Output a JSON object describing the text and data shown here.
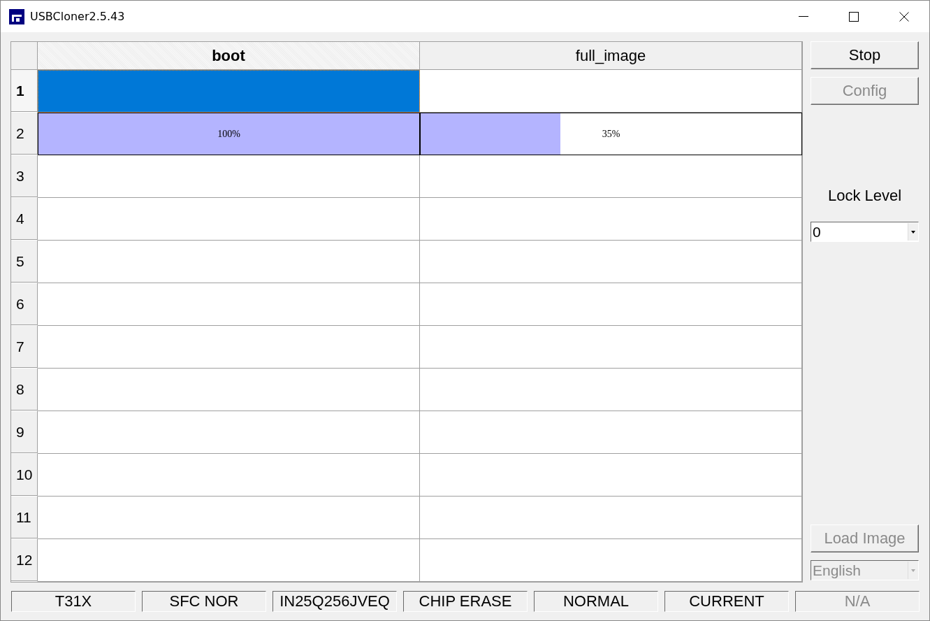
{
  "window": {
    "title": "USBCloner2.5.43"
  },
  "table": {
    "columns": [
      {
        "label": "boot",
        "selected": true
      },
      {
        "label": "full_image",
        "selected": false
      }
    ],
    "rows": [
      {
        "label": "1",
        "selected": true,
        "cells": [
          {
            "kind": "empty",
            "selected": true
          },
          {
            "kind": "empty",
            "selected": false
          }
        ]
      },
      {
        "label": "2",
        "selected": false,
        "cells": [
          {
            "kind": "progress",
            "level": 1.0,
            "text": "100%"
          },
          {
            "kind": "progress",
            "level": 0.367,
            "text": "35%"
          }
        ]
      },
      {
        "label": "3",
        "selected": false,
        "cells": [
          {
            "kind": "empty",
            "selected": false
          },
          {
            "kind": "empty",
            "selected": false
          }
        ]
      },
      {
        "label": "4",
        "selected": false,
        "cells": [
          {
            "kind": "empty",
            "selected": false
          },
          {
            "kind": "empty",
            "selected": false
          }
        ]
      },
      {
        "label": "5",
        "selected": false,
        "cells": [
          {
            "kind": "empty",
            "selected": false
          },
          {
            "kind": "empty",
            "selected": false
          }
        ]
      },
      {
        "label": "6",
        "selected": false,
        "cells": [
          {
            "kind": "empty",
            "selected": false
          },
          {
            "kind": "empty",
            "selected": false
          }
        ]
      },
      {
        "label": "7",
        "selected": false,
        "cells": [
          {
            "kind": "empty",
            "selected": false
          },
          {
            "kind": "empty",
            "selected": false
          }
        ]
      },
      {
        "label": "8",
        "selected": false,
        "cells": [
          {
            "kind": "empty",
            "selected": false
          },
          {
            "kind": "empty",
            "selected": false
          }
        ]
      },
      {
        "label": "9",
        "selected": false,
        "cells": [
          {
            "kind": "empty",
            "selected": false
          },
          {
            "kind": "empty",
            "selected": false
          }
        ]
      },
      {
        "label": "10",
        "selected": false,
        "cells": [
          {
            "kind": "empty",
            "selected": false
          },
          {
            "kind": "empty",
            "selected": false
          }
        ]
      },
      {
        "label": "11",
        "selected": false,
        "cells": [
          {
            "kind": "empty",
            "selected": false
          },
          {
            "kind": "empty",
            "selected": false
          }
        ]
      },
      {
        "label": "12",
        "selected": false,
        "cells": [
          {
            "kind": "empty",
            "selected": false
          },
          {
            "kind": "empty",
            "selected": false
          }
        ]
      }
    ]
  },
  "sidebar": {
    "stop_button": {
      "label": "Stop",
      "disabled": false
    },
    "config_button": {
      "label": "Config",
      "disabled": true
    },
    "lock_level": {
      "label": "Lock Level",
      "value": "0",
      "disabled": false
    },
    "load_image_button": {
      "label": "Load Image",
      "disabled": true
    },
    "language": {
      "value": "English",
      "disabled": true
    }
  },
  "status_bar": [
    {
      "text": "T31X",
      "disabled": false
    },
    {
      "text": "SFC NOR",
      "disabled": false
    },
    {
      "text": "IN25Q256JVEQ",
      "disabled": false
    },
    {
      "text": "CHIP ERASE",
      "disabled": false
    },
    {
      "text": "NORMAL",
      "disabled": false
    },
    {
      "text": "CURRENT",
      "disabled": false
    },
    {
      "text": "N/A",
      "disabled": true
    }
  ]
}
